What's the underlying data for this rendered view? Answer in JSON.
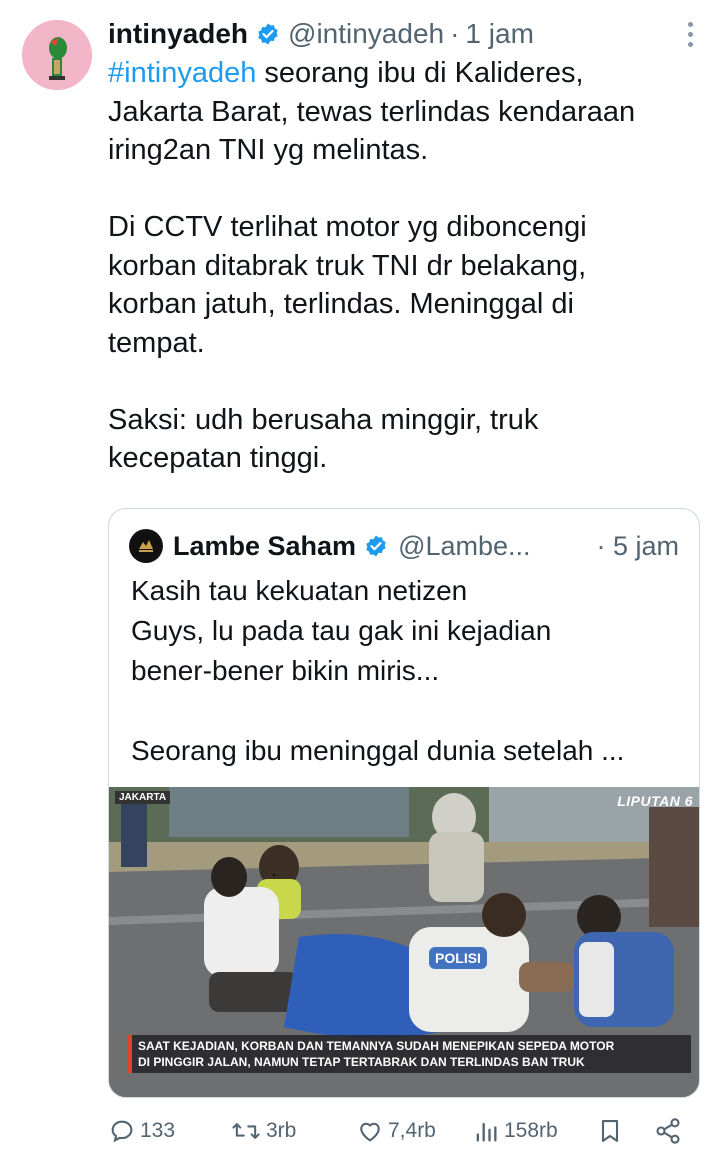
{
  "tweet": {
    "display_name": "intinyadeh",
    "handle": "@intinyadeh",
    "separator": "·",
    "time": "1 jam",
    "hashtag": "#intinyadeh",
    "line1_rest": " seorang ibu di Kalideres,",
    "lines_a": [
      "Jakarta Barat, tewas terlindas kendaraan",
      "iring2an TNI yg melintas."
    ],
    "lines_b": [
      "Di CCTV terlihat motor yg diboncengi",
      "korban ditabrak truk TNI dr belakang,",
      "korban jatuh, terlindas. Meninggal di",
      "tempat."
    ],
    "lines_c": [
      "Saksi: udh berusaha minggir, truk",
      "kecepatan tinggi."
    ]
  },
  "quote": {
    "display_name": "Lambe Saham",
    "handle": "@Lambe...",
    "separator": "·",
    "time": "5 jam",
    "lines_a": [
      "Kasih tau kekuatan netizen",
      "Guys, lu pada tau gak ini kejadian",
      "bener-bener bikin miris..."
    ],
    "lines_b": [
      "Seorang ibu meninggal dunia setelah ..."
    ],
    "media": {
      "location_tag": "JAKARTA",
      "channel": "LIPUTAN 6",
      "vest_text": "POLISI",
      "caption_lines": [
        "SAAT KEJADIAN, KORBAN DAN TEMANNYA SUDAH MENEPIKAN SEPEDA MOTOR",
        "DI PINGGIR JALAN, NAMUN TETAP TERTABRAK DAN TERLINDAS BAN TRUK"
      ]
    }
  },
  "actions": {
    "replies": "133",
    "retweets": "3rb",
    "likes": "7,4rb",
    "views": "158rb"
  },
  "icons": [
    "verified-badge-icon",
    "more-icon",
    "reply-icon",
    "retweet-icon",
    "like-icon",
    "views-icon",
    "bookmark-icon",
    "share-icon"
  ],
  "colors": {
    "link": "#1d9bf0",
    "muted": "#536471",
    "verified": "#1d9bf0",
    "border": "#cfd9de"
  }
}
